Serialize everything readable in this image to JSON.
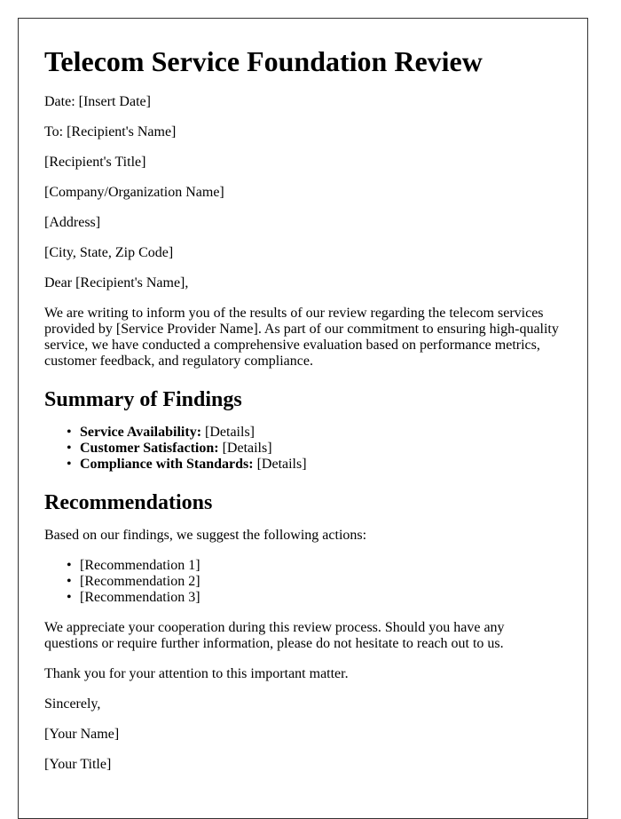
{
  "document": {
    "title": "Telecom Service Foundation Review",
    "header_lines": [
      "Date: [Insert Date]",
      "To: [Recipient's Name]",
      "[Recipient's Title]",
      "[Company/Organization Name]",
      "[Address]",
      "[City, State, Zip Code]"
    ],
    "salutation": "Dear [Recipient's Name],",
    "intro": "We are writing to inform you of the results of our review regarding the telecom services provided by [Service Provider Name]. As part of our commitment to ensuring high-quality service, we have conducted a comprehensive evaluation based on performance metrics, customer feedback, and regulatory compliance.",
    "findings": {
      "heading": "Summary of Findings",
      "items": [
        {
          "label": "Service Availability:",
          "value": " [Details]"
        },
        {
          "label": "Customer Satisfaction:",
          "value": " [Details]"
        },
        {
          "label": "Compliance with Standards:",
          "value": " [Details]"
        }
      ]
    },
    "recommendations": {
      "heading": "Recommendations",
      "intro": "Based on our findings, we suggest the following actions:",
      "items": [
        "[Recommendation 1]",
        "[Recommendation 2]",
        "[Recommendation 3]"
      ]
    },
    "closing_paragraph": "We appreciate your cooperation during this review process. Should you have any questions or require further information, please do not hesitate to reach out to us.",
    "thanks": "Thank you for your attention to this important matter.",
    "signoff": "Sincerely,",
    "signature_name": "[Your Name]",
    "signature_title": "[Your Title]",
    "bullet_glyph": "•"
  }
}
